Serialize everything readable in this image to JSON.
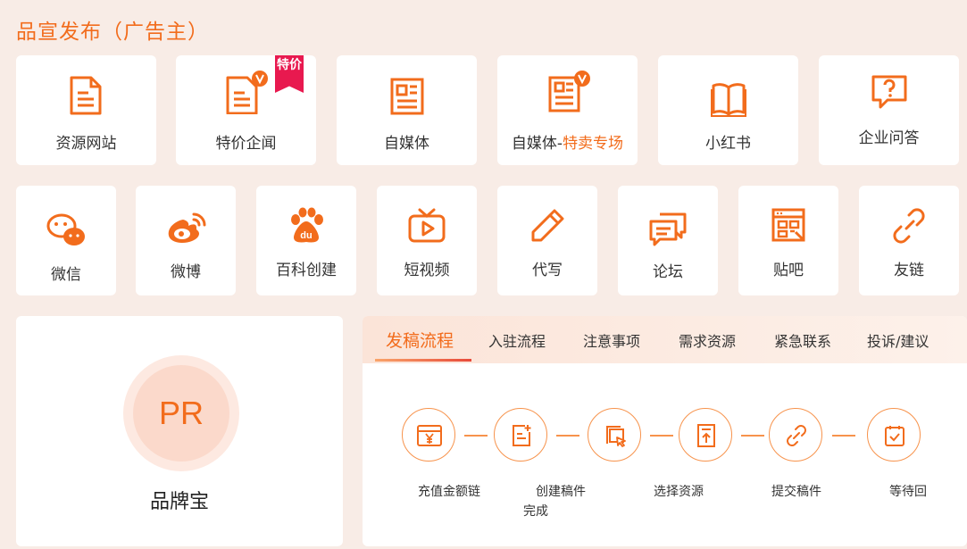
{
  "section_title": "品宣发布（广告主）",
  "row1": [
    {
      "label": "资源网站",
      "icon": "document-icon"
    },
    {
      "label": "特价企闻",
      "icon": "document-v-icon",
      "ribbon": "特价"
    },
    {
      "label": "自媒体",
      "icon": "newspaper-icon"
    },
    {
      "label_main": "自媒体-",
      "label_highlight": "特卖专场",
      "icon": "newspaper-v-icon"
    },
    {
      "label": "小红书",
      "icon": "book-icon"
    },
    {
      "label": "企业问答",
      "icon": "question-chat-icon"
    }
  ],
  "row2": [
    {
      "label": "微信",
      "icon": "wechat-icon"
    },
    {
      "label": "微博",
      "icon": "weibo-icon"
    },
    {
      "label": "百科创建",
      "icon": "baidu-paw-icon"
    },
    {
      "label": "短视频",
      "icon": "tv-play-icon"
    },
    {
      "label": "代写",
      "icon": "pencil-icon"
    },
    {
      "label": "论坛",
      "icon": "forum-chat-icon"
    },
    {
      "label": "贴吧",
      "icon": "tieba-icon"
    },
    {
      "label": "友链",
      "icon": "link-icon"
    }
  ],
  "brand": {
    "badge": "PR",
    "name": "品牌宝"
  },
  "tabs": [
    {
      "label": "发稿流程",
      "active": true
    },
    {
      "label": "入驻流程"
    },
    {
      "label": "注意事项"
    },
    {
      "label": "需求资源"
    },
    {
      "label": "紧急联系"
    },
    {
      "label": "投诉/建议"
    }
  ],
  "steps": [
    {
      "label": "充值金额链",
      "icon": "yen-card-icon"
    },
    {
      "label": "创建稿件完成",
      "icon": "edit-doc-icon"
    },
    {
      "label": "选择资源",
      "icon": "select-pages-icon"
    },
    {
      "label": "提交稿件",
      "icon": "submit-doc-icon"
    },
    {
      "label": "提交稿件",
      "icon": "link-icon"
    },
    {
      "label": "等待回",
      "icon": "check-box-icon"
    }
  ],
  "colors": {
    "accent": "#f26c1c",
    "ribbon": "#e8194f",
    "background": "#f8ece6"
  }
}
